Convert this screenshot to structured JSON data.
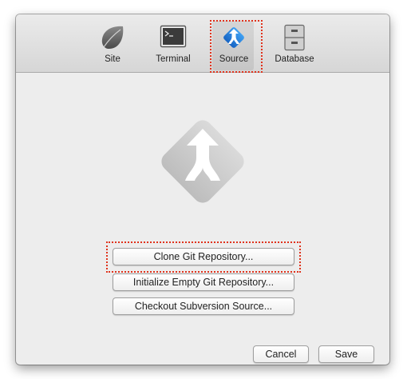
{
  "toolbar": {
    "tabs": [
      {
        "label": "Site",
        "icon": "leaf-icon"
      },
      {
        "label": "Terminal",
        "icon": "terminal-icon"
      },
      {
        "label": "Source",
        "icon": "source-merge-icon",
        "selected": true
      },
      {
        "label": "Database",
        "icon": "database-cabinet-icon"
      }
    ]
  },
  "main": {
    "logo_icon": "git-merge-logo-icon",
    "buttons": {
      "clone": "Clone Git Repository...",
      "init": "Initialize Empty Git Repository...",
      "checkout": "Checkout Subversion Source..."
    }
  },
  "footer": {
    "cancel_label": "Cancel",
    "save_label": "Save"
  },
  "colors": {
    "highlight": "#e0321c",
    "source_icon": "#1a78d6",
    "logo_gray": "#c8c8c8"
  }
}
